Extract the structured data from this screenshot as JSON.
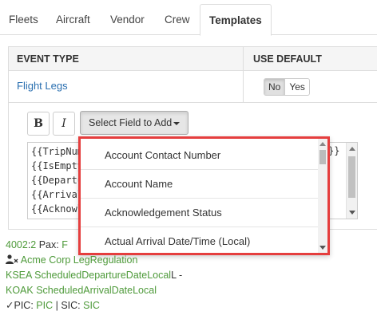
{
  "tabs": [
    {
      "label": "Fleets",
      "active": false
    },
    {
      "label": "Aircraft",
      "active": false
    },
    {
      "label": "Vendor",
      "active": false
    },
    {
      "label": "Crew",
      "active": false
    },
    {
      "label": "Templates",
      "active": true
    }
  ],
  "table": {
    "headers": {
      "event_type": "EVENT TYPE",
      "use_default": "USE DEFAULT"
    },
    "row": {
      "event_type": "Flight Legs",
      "toggle": {
        "no": "No",
        "yes": "Yes",
        "selected": "No"
      }
    }
  },
  "editor": {
    "bold_label": "B",
    "italic_label": "I",
    "field_button_label": "Select Field to Add",
    "text_lines": [
      "{{TripNum",
      "{{IsEmptyL",
      "{{Departu",
      "{{ArrivalAi",
      "{{Acknowl"
    ],
    "text_line_right": "}}"
  },
  "dropdown": {
    "items": [
      "Account Contact Number",
      "Account Name",
      "Acknowledgement Status",
      "Actual Arrival Date/Time (Local)"
    ]
  },
  "preview": {
    "trip_num": "4002",
    "leg_sep": ":",
    "leg_num": "2",
    "pax_label": " Pax: ",
    "pax_value": "F",
    "account": "Acme Corp LegRegulation",
    "dep_line": "KSEA ScheduledDepartureDateLocal",
    "dep_suffix": "L -",
    "arr_line": "KOAK ScheduledArrivalDateLocal",
    "pic_label": "PIC: ",
    "pic_value": "PIC",
    "sic_sep": " | SIC: ",
    "sic_value": "SIC"
  },
  "colors": {
    "link": "#2a6fb0",
    "preview_green": "#4e9a3a",
    "highlight_border": "#e53e3e"
  }
}
